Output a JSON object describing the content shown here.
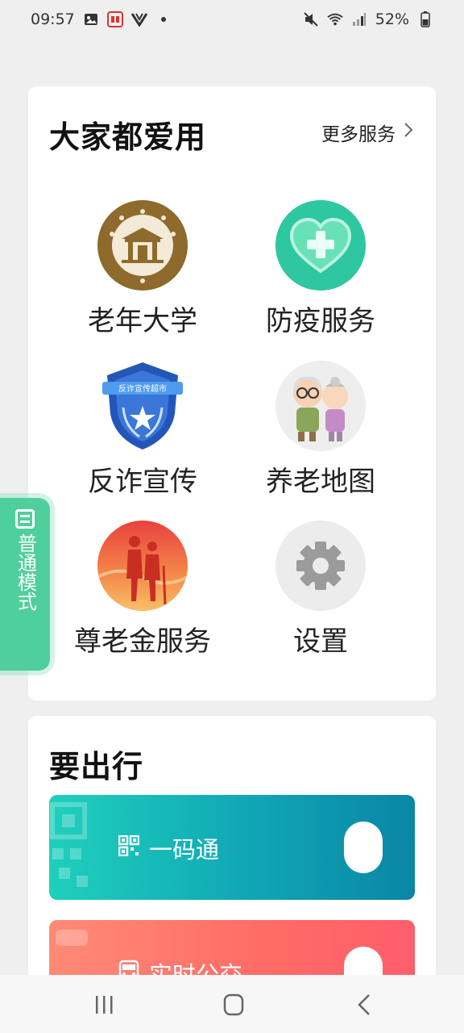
{
  "status": {
    "time": "09:57",
    "battery": "52%"
  },
  "popular": {
    "title": "大家都爱用",
    "more_label": "更多服务",
    "items": [
      {
        "label": "老年大学",
        "icon": "university-seal-icon"
      },
      {
        "label": "防疫服务",
        "icon": "heart-cross-icon"
      },
      {
        "label": "反诈宣传",
        "icon": "police-badge-icon"
      },
      {
        "label": "养老地图",
        "icon": "elderly-couple-icon"
      },
      {
        "label": "尊老金服务",
        "icon": "elderly-sunset-icon"
      },
      {
        "label": "设置",
        "icon": "gear-icon"
      }
    ],
    "badge_text": "反诈宣传超市"
  },
  "travel": {
    "title": "要出行",
    "qr_label": "一码通",
    "bus_label": "实时公交"
  },
  "mode_tab": {
    "label": "普通模式"
  },
  "colors": {
    "accent_green": "#4fcf9b",
    "qr_gradient": "#10a6b6",
    "bus_gradient": "#ff6b67"
  }
}
